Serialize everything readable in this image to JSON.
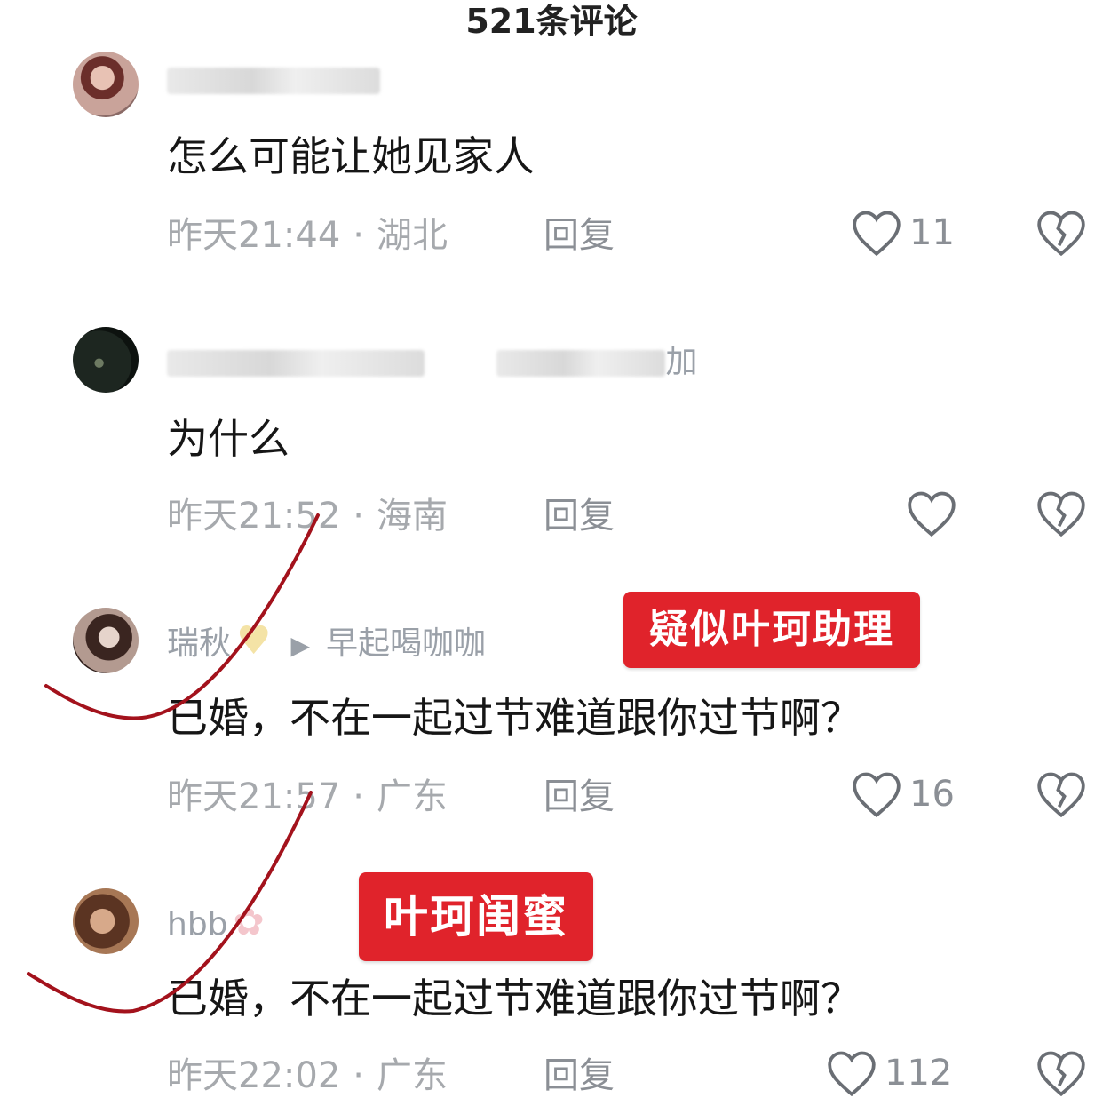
{
  "header": {
    "title": "521条评论"
  },
  "comments": [
    {
      "username": "",
      "text": "怎么可能让她见家人",
      "time": "昨天21:44",
      "location": "湖北",
      "reply_label": "回复",
      "likes": "11"
    },
    {
      "username": "",
      "username_suffix": "加",
      "text": "为什么",
      "time": "昨天21:52",
      "location": "海南",
      "reply_label": "回复",
      "likes": ""
    },
    {
      "username": "瑞秋",
      "reply_to": "早起喝咖咖",
      "text": "已婚，不在一起过节难道跟你过节啊？",
      "time": "昨天21:57",
      "location": "广东",
      "reply_label": "回复",
      "likes": "16",
      "tag": "疑似叶珂助理"
    },
    {
      "username": "hbb",
      "text": "已婚，不在一起过节难道跟你过节啊？",
      "time": "昨天22:02",
      "location": "广东",
      "reply_label": "回复",
      "likes": "112",
      "tag": "叶珂闺蜜"
    }
  ],
  "colors": {
    "tag_bg": "#e0232b",
    "scribble": "#a3121c",
    "meta_text": "#a6a9ad"
  }
}
